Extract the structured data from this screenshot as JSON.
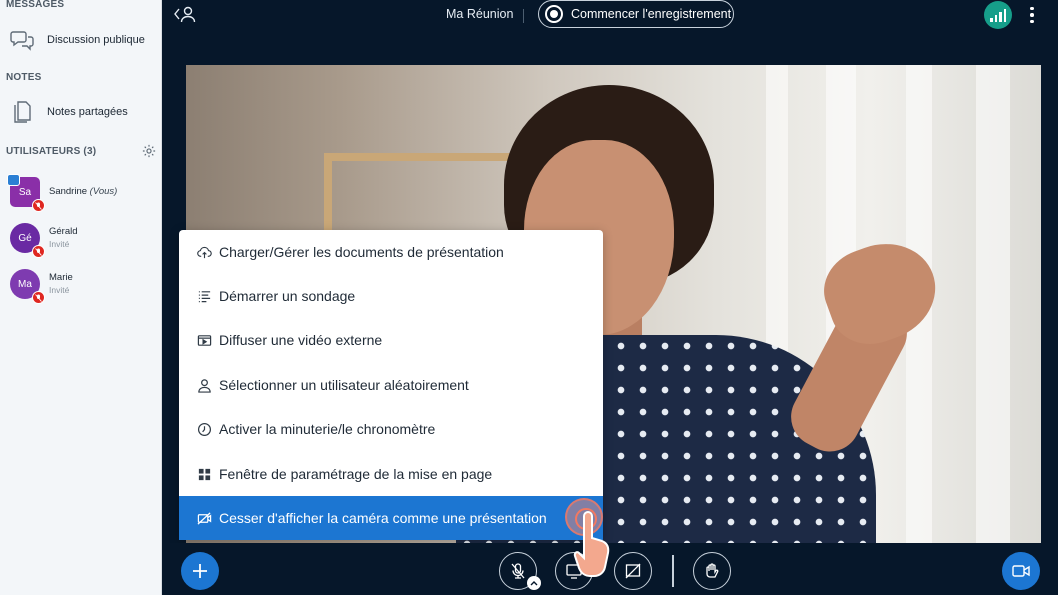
{
  "sidebar": {
    "messages_title": "MESSAGES",
    "public_chat": "Discussion publique",
    "notes_title": "NOTES",
    "shared_notes": "Notes partagées",
    "users_title": "UTILISATEURS (3)",
    "users": [
      {
        "initials": "Sa",
        "name": "Sandrine",
        "suffix": "(Vous)",
        "role": "",
        "color": "#8a2fa8"
      },
      {
        "initials": "Gé",
        "name": "Gérald",
        "suffix": "",
        "role": "Invité",
        "color": "#6a2aa3"
      },
      {
        "initials": "Ma",
        "name": "Marie",
        "suffix": "",
        "role": "Invité",
        "color": "#7e3bb0"
      }
    ]
  },
  "topbar": {
    "meeting_title": "Ma Réunion",
    "record_label": "Commencer l'enregistrement"
  },
  "menu": {
    "items": [
      {
        "label": "Charger/Gérer les documents de présentation",
        "icon": "cloud-upload-icon"
      },
      {
        "label": "Démarrer un sondage",
        "icon": "poll-list-icon"
      },
      {
        "label": "Diffuser une vidéo externe",
        "icon": "external-video-icon"
      },
      {
        "label": "Sélectionner un utilisateur aléatoirement",
        "icon": "user-icon"
      },
      {
        "label": "Activer la minuterie/le chronomètre",
        "icon": "timer-icon"
      },
      {
        "label": "Fenêtre de paramétrage de la mise en page",
        "icon": "layout-icon"
      },
      {
        "label": "Cesser d'afficher la caméra comme une présentation",
        "icon": "camera-off-presentation-icon"
      }
    ]
  },
  "colors": {
    "accent": "#1c76d2",
    "background": "#06172a",
    "signal": "#169e8a",
    "muted_badge": "#df2721"
  }
}
